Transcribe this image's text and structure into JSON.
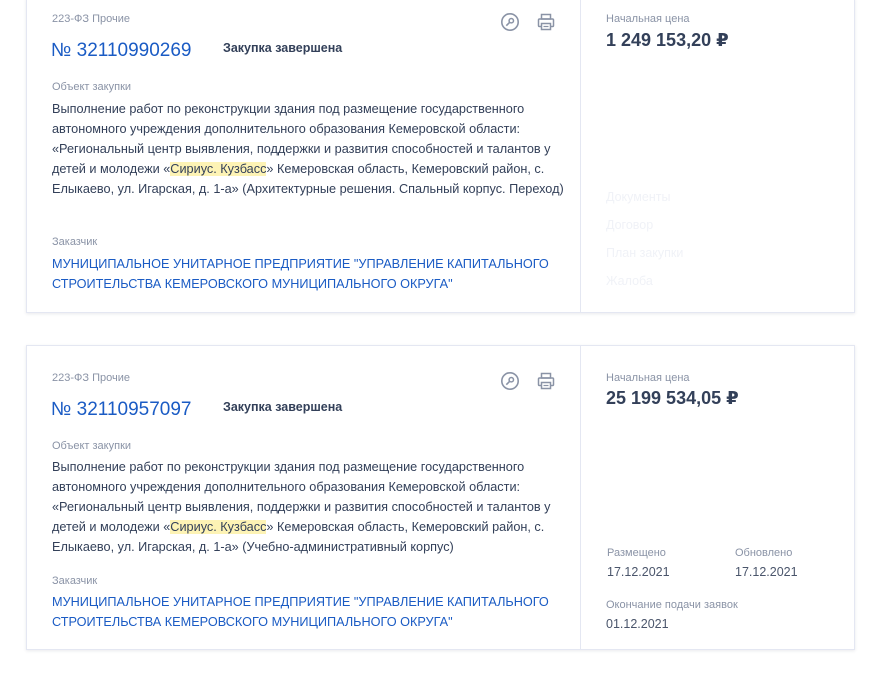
{
  "cards": [
    {
      "law": "223-ФЗ Прочие",
      "number": "№ 32110990269",
      "status": "Закупка завершена",
      "object_label": "Объект закупки",
      "desc_pre": "Выполнение работ по реконструкции здания под размещение государственного автономного учреждения дополнительного образования Кемеровской области: «Региональный центр выявления, поддержки и развития способностей и талантов у детей и молодежи «",
      "desc_hl": "Сириус. Кузбасс",
      "desc_post": "» Кемеровская область, Кемеровский район, с. Елыкаево, ул. Игарская, д. 1-а» (Архитектурные решения. Спальный корпус. Переход)",
      "customer_label": "Заказчик",
      "customer": "МУНИЦИПАЛЬНОЕ УНИТАРНОЕ ПРЕДПРИЯТИЕ \"УПРАВЛЕНИЕ КАПИТАЛЬНОГО СТРОИТЕЛЬСТВА КЕМЕРОВСКОГО МУНИЦИПАЛЬНОГО ОКРУГА\"",
      "price_label": "Начальная цена",
      "price": "1 249 153,20 ₽",
      "links": [
        "Документы",
        "Договор",
        "План закупки",
        "Жалоба"
      ]
    },
    {
      "law": "223-ФЗ Прочие",
      "number": "№ 32110957097",
      "status": "Закупка завершена",
      "object_label": "Объект закупки",
      "desc_pre": "Выполнение работ по реконструкции здания под размещение государственного автономного учреждения дополнительного образования Кемеровской области: «Региональный центр выявления, поддержки и развития способностей и талантов у детей и молодежи «",
      "desc_hl": "Сириус. Кузбасс",
      "desc_post": "» Кемеровская область, Кемеровский район, с. Елыкаево, ул. Игарская, д. 1-а» (Учебно-административный корпус)",
      "customer_label": "Заказчик",
      "customer": "МУНИЦИПАЛЬНОЕ УНИТАРНОЕ ПРЕДПРИЯТИЕ \"УПРАВЛЕНИЕ КАПИТАЛЬНОГО СТРОИТЕЛЬСТВА КЕМЕРОВСКОГО МУНИЦИПАЛЬНОГО ОКРУГА\"",
      "price_label": "Начальная цена",
      "price": "25 199 534,05 ₽",
      "posted_label": "Размещено",
      "posted": "17.12.2021",
      "updated_label": "Обновлено",
      "updated": "17.12.2021",
      "deadline_label": "Окончание подачи заявок",
      "deadline": "01.12.2021"
    }
  ],
  "icons": {
    "timer": "clock-key-icon",
    "print": "printer-icon"
  },
  "colors": {
    "link": "#1a5bc4",
    "text": "#334059",
    "muted": "#8a93a6",
    "highlight": "#fdf3b5",
    "border": "#e4e7f2"
  }
}
